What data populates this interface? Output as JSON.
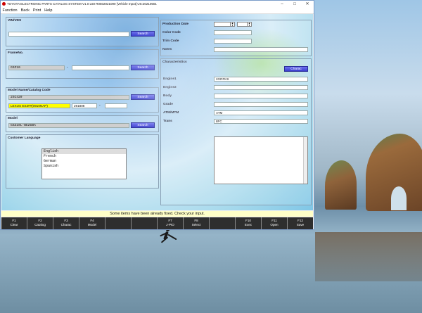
{
  "window": {
    "title": "TOYOTA ELECTRONIC PARTS CATALOG SYSTEM V1.0 L60 R0502021090 [Vehicle Input] US:20210501"
  },
  "menu": [
    "Function",
    "Back",
    "Print",
    "Help"
  ],
  "vin": {
    "label": "VIN/VDS",
    "value": "",
    "search": "Search"
  },
  "frame": {
    "label": "FrameNo.",
    "prefix": "GSZ10",
    "dash": "-",
    "value": "",
    "search": "Search"
  },
  "model_name": {
    "label": "Model Name/Catalog Code",
    "value": "2SC420",
    "search": "Search",
    "name": "LEXUS ES3##(0910NAP)",
    "code": "291808",
    "dash": "-",
    "extra": ""
  },
  "model": {
    "label": "Model",
    "value": "GSZ10L-BEZGBA",
    "search": "Search"
  },
  "language": {
    "label": "Customer Language",
    "options": [
      "English",
      "French",
      "German",
      "Spanish"
    ],
    "selected": "English"
  },
  "production": {
    "date_label": "Production Date",
    "color_label": "Color Code",
    "trim_label": "Trim Code",
    "notes_label": "Notes"
  },
  "characteristics": {
    "label": "Characteristics",
    "button": "Charac",
    "rows": [
      {
        "label": "Engine1",
        "value": "2GRFKS"
      },
      {
        "label": "Engine2",
        "value": ""
      },
      {
        "label": "Body",
        "value": ""
      },
      {
        "label": "Grade",
        "value": ""
      },
      {
        "label": "ATM/MTM",
        "value": "ATM"
      },
      {
        "label": "Trans",
        "value": "8FC"
      }
    ]
  },
  "status": "Some items have been already fixed. Check your input.",
  "fkeys": [
    {
      "key": "F1",
      "label": "Clear"
    },
    {
      "key": "F2",
      "label": "Catalog"
    },
    {
      "key": "F3",
      "label": "Charac"
    },
    {
      "key": "F4",
      "label": "Model"
    },
    {
      "key": "",
      "label": ""
    },
    {
      "key": "",
      "label": ""
    },
    {
      "key": "F7",
      "label": "J-PIO"
    },
    {
      "key": "F8",
      "label": "Select"
    },
    {
      "key": "",
      "label": ""
    },
    {
      "key": "F10",
      "label": "Exec"
    },
    {
      "key": "F11",
      "label": "Open"
    },
    {
      "key": "F12",
      "label": "Save"
    }
  ],
  "colors": {
    "button": "#3b3fd0",
    "status_bg": "#ffffc8",
    "catalog_highlight": "#ffff00",
    "fkey_bar": "#2e2e2e"
  }
}
